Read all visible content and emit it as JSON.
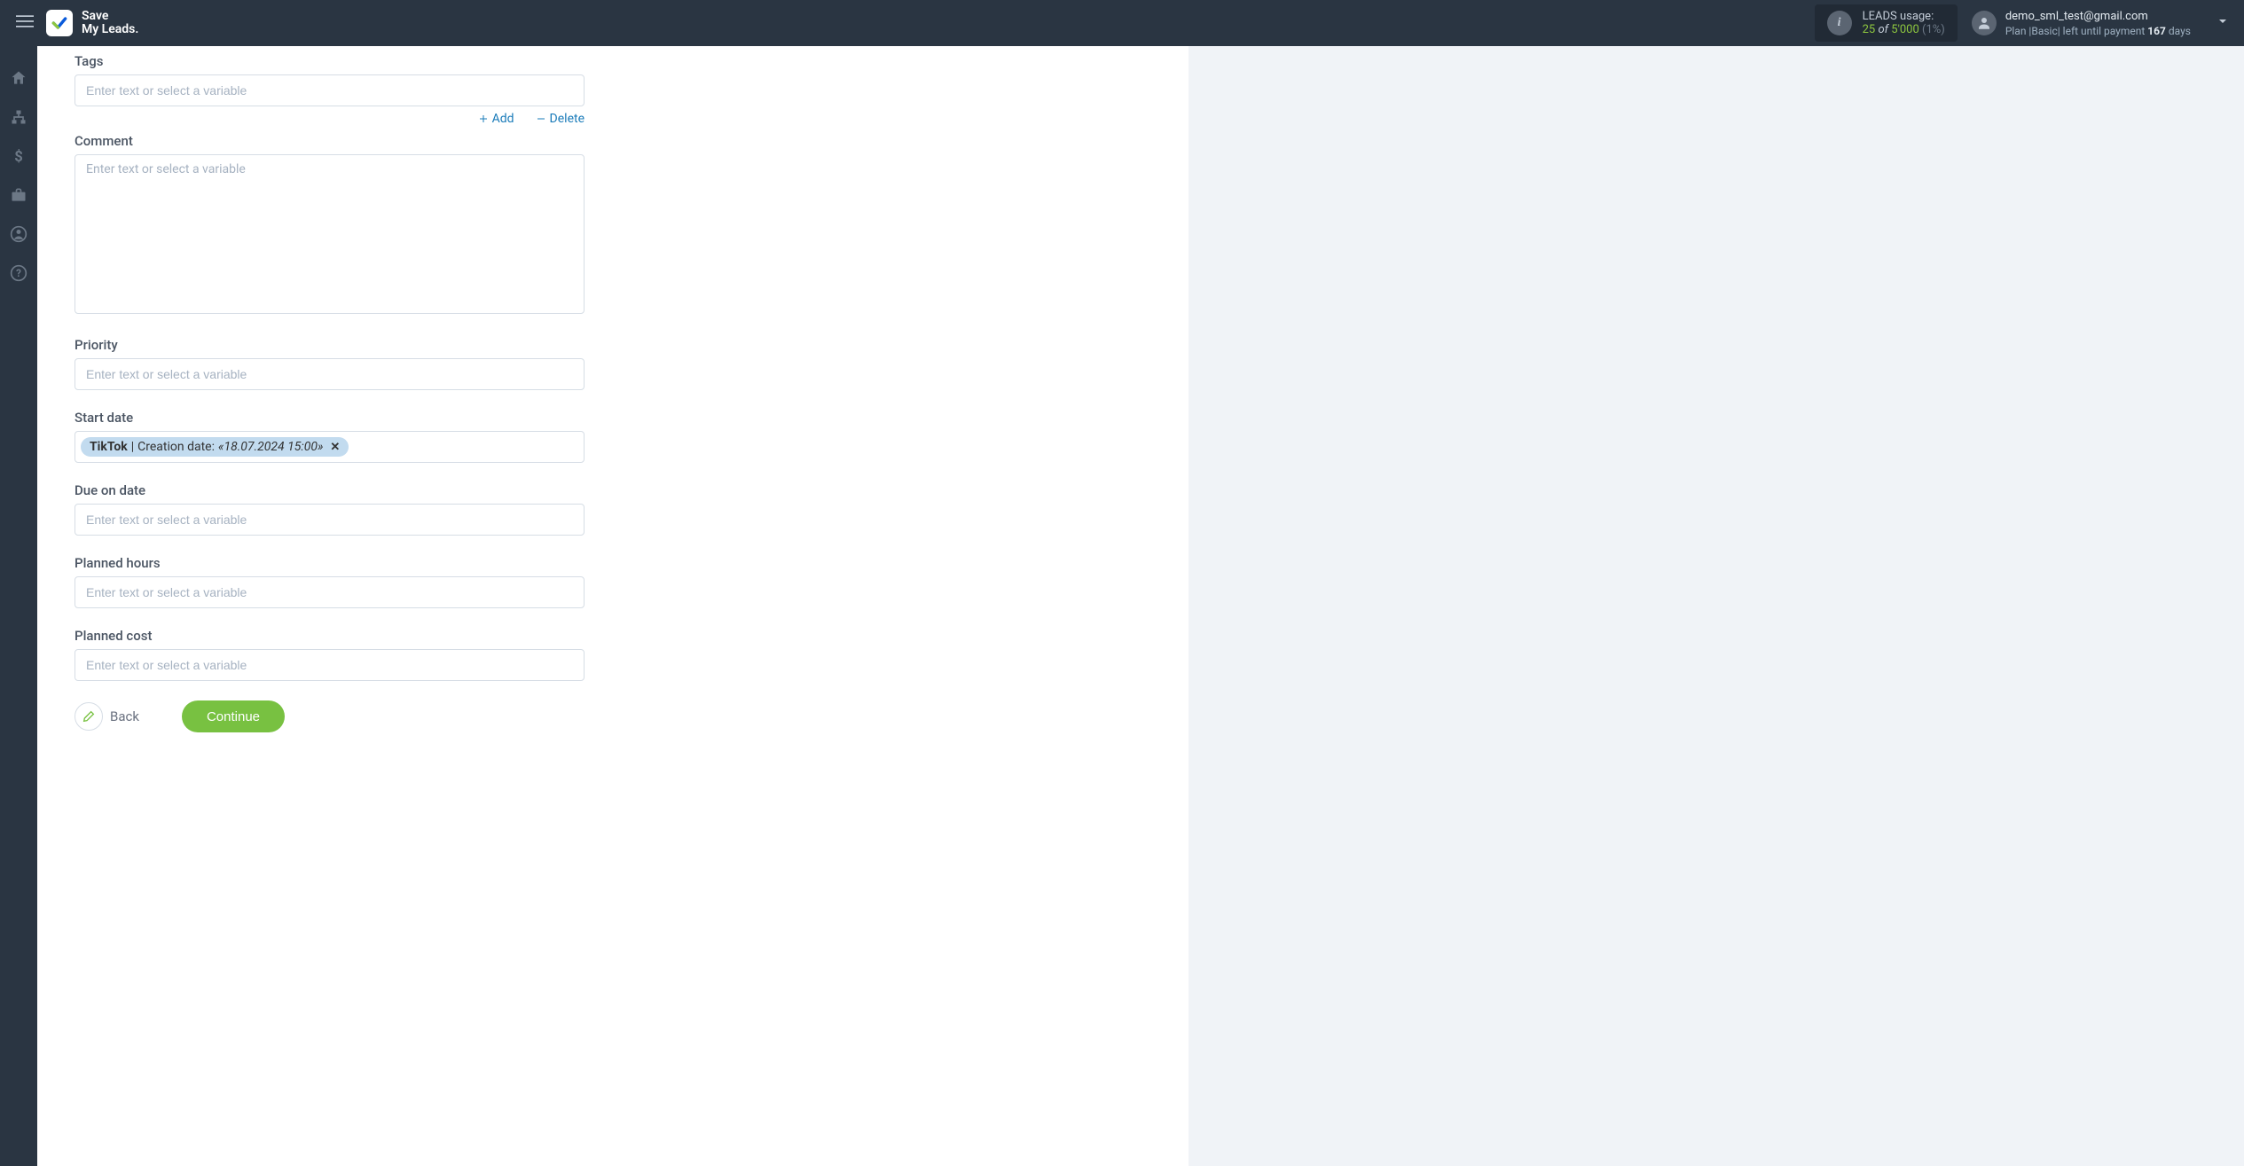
{
  "header": {
    "logo_text": "Save\nMy Leads.",
    "leads_usage": {
      "title": "LEADS usage:",
      "used": "25",
      "of": "of",
      "total": "5'000",
      "pct": "(1%)"
    },
    "account": {
      "email": "demo_sml_test@gmail.com",
      "plan_prefix": "Plan |Basic| left until payment ",
      "days_num": "167",
      "days_suffix": " days"
    }
  },
  "form": {
    "tags": {
      "label": "Tags",
      "placeholder": "Enter text or select a variable"
    },
    "add_label": "Add",
    "delete_label": "Delete",
    "comment": {
      "label": "Comment",
      "placeholder": "Enter text or select a variable"
    },
    "priority": {
      "label": "Priority",
      "placeholder": "Enter text or select a variable"
    },
    "start_date": {
      "label": "Start date",
      "token": {
        "source": "TikTok",
        "sep": " | ",
        "field": "Creation date: ",
        "value": "«18.07.2024 15:00»"
      }
    },
    "due_on_date": {
      "label": "Due on date",
      "placeholder": "Enter text or select a variable"
    },
    "planned_hours": {
      "label": "Planned hours",
      "placeholder": "Enter text or select a variable"
    },
    "planned_cost": {
      "label": "Planned cost",
      "placeholder": "Enter text or select a variable"
    },
    "back_label": "Back",
    "continue_label": "Continue"
  }
}
